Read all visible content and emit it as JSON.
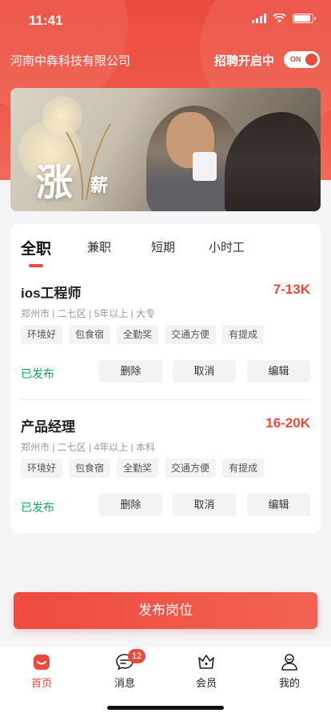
{
  "status_bar": {
    "time": "11:41"
  },
  "header": {
    "company": "河南中犇科技有限公司",
    "recruit_status": "招聘开启中",
    "toggle_label": "ON"
  },
  "banner": {
    "big_text": "涨",
    "small_text": "薪"
  },
  "tabs": [
    {
      "label": "全职",
      "active": true
    },
    {
      "label": "兼职",
      "active": false
    },
    {
      "label": "短期",
      "active": false
    },
    {
      "label": "小时工",
      "active": false
    }
  ],
  "jobs": [
    {
      "title": "ios工程师",
      "salary": "7-13K",
      "meta": "郑州市 | 二七区 | 5年以上 | 大专",
      "tags": [
        "环境好",
        "包食宿",
        "全勤奖",
        "交通方便",
        "有提成"
      ],
      "status": "已发布",
      "actions": [
        "删除",
        "取消",
        "编辑"
      ]
    },
    {
      "title": "产品经理",
      "salary": "16-20K",
      "meta": "郑州市 | 二七区 | 4年以上 | 本科",
      "tags": [
        "环境好",
        "包食宿",
        "全勤奖",
        "交通方便",
        "有提成"
      ],
      "status": "已发布",
      "actions": [
        "删除",
        "取消",
        "编辑"
      ]
    }
  ],
  "publish_button": "发布岗位",
  "bottom_nav": [
    {
      "label": "首页",
      "icon": "home-icon",
      "active": true
    },
    {
      "label": "消息",
      "icon": "message-icon",
      "badge": "12"
    },
    {
      "label": "会员",
      "icon": "crown-icon"
    },
    {
      "label": "我的",
      "icon": "profile-icon"
    }
  ],
  "colors": {
    "brand": "#e84a3b",
    "published": "#13a36d"
  }
}
